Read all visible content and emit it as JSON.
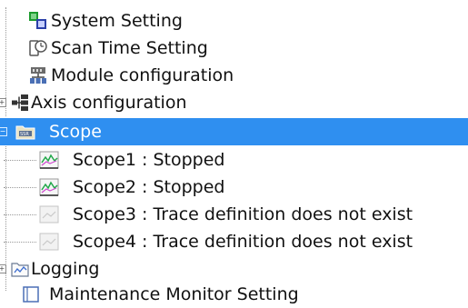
{
  "tree": {
    "system_setting": {
      "label": "System Setting",
      "icon": "system-setting-icon"
    },
    "scan_time_setting": {
      "label": "Scan Time Setting",
      "icon": "scan-time-icon"
    },
    "module_configuration": {
      "label": "Module configuration",
      "icon": "module-config-icon"
    },
    "axis_configuration": {
      "label": "Axis configuration",
      "icon": "axis-config-icon"
    },
    "scope": {
      "label": "Scope",
      "icon": "scope-folder-icon",
      "children": [
        {
          "label": "Scope1 : Stopped",
          "icon": "trace-active-icon"
        },
        {
          "label": "Scope2 : Stopped",
          "icon": "trace-active-icon"
        },
        {
          "label": "Scope3 : Trace definition does not exist",
          "icon": "trace-empty-icon"
        },
        {
          "label": "Scope4 : Trace definition does not exist",
          "icon": "trace-empty-icon"
        }
      ]
    },
    "logging": {
      "label": "Logging",
      "icon": "logging-icon"
    },
    "maintenance_monitor": {
      "label": "Maintenance Monitor Setting",
      "icon": "maintenance-icon"
    }
  },
  "colors": {
    "selection": "#2f8ff0",
    "text": "#111111"
  }
}
